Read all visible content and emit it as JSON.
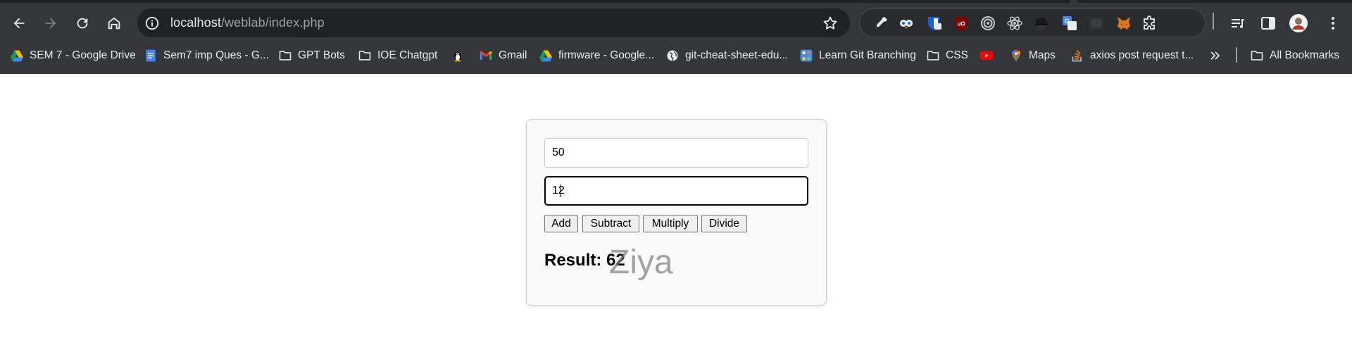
{
  "browser": {
    "url": {
      "host": "localhost",
      "path": "/weblab/index.php"
    },
    "nav_icons": [
      "back-arrow-icon",
      "forward-arrow-icon",
      "reload-icon",
      "home-icon"
    ],
    "extensions": [
      "eyedropper-icon",
      "owl-icon",
      "bitwarden-icon",
      "ublock-icon",
      "target-icon",
      "react-icon",
      "hacker-icon",
      "translate-icon",
      "dark-box-icon",
      "metamask-icon",
      "puzzle-icon"
    ],
    "bookmarks": [
      {
        "label": "SEM 7 - Google Drive",
        "icon": "google-drive-icon"
      },
      {
        "label": "Sem7 imp Ques - G...",
        "icon": "google-docs-icon"
      },
      {
        "label": "GPT Bots",
        "icon": "folder-icon"
      },
      {
        "label": "IOE Chatgpt",
        "icon": "folder-icon"
      },
      {
        "label": "",
        "icon": "linux-penguin-icon"
      },
      {
        "label": "Gmail",
        "icon": "gmail-icon"
      },
      {
        "label": "firmware - Google...",
        "icon": "google-drive-icon"
      },
      {
        "label": "git-cheat-sheet-edu...",
        "icon": "globe-icon"
      },
      {
        "label": "Learn Git Branching",
        "icon": "git-branching-icon"
      },
      {
        "label": "CSS",
        "icon": "folder-icon"
      },
      {
        "label": "",
        "icon": "youtube-icon"
      },
      {
        "label": "Maps",
        "icon": "google-maps-icon"
      },
      {
        "label": "axios post request t...",
        "icon": "stackoverflow-icon"
      }
    ],
    "all_bookmarks": "All Bookmarks"
  },
  "calculator": {
    "num1": "50",
    "num2": "12",
    "buttons": {
      "add": "Add",
      "subtract": "Subtract",
      "multiply": "Multiply",
      "divide": "Divide"
    },
    "result_label": "Result:",
    "result_value": "62",
    "watermark": "Ziya"
  },
  "colors": {
    "chrome_bg": "#35363a",
    "omnibox_bg": "#202124",
    "page_bg": "#ffffff",
    "card_bg": "#f9f9f9"
  }
}
